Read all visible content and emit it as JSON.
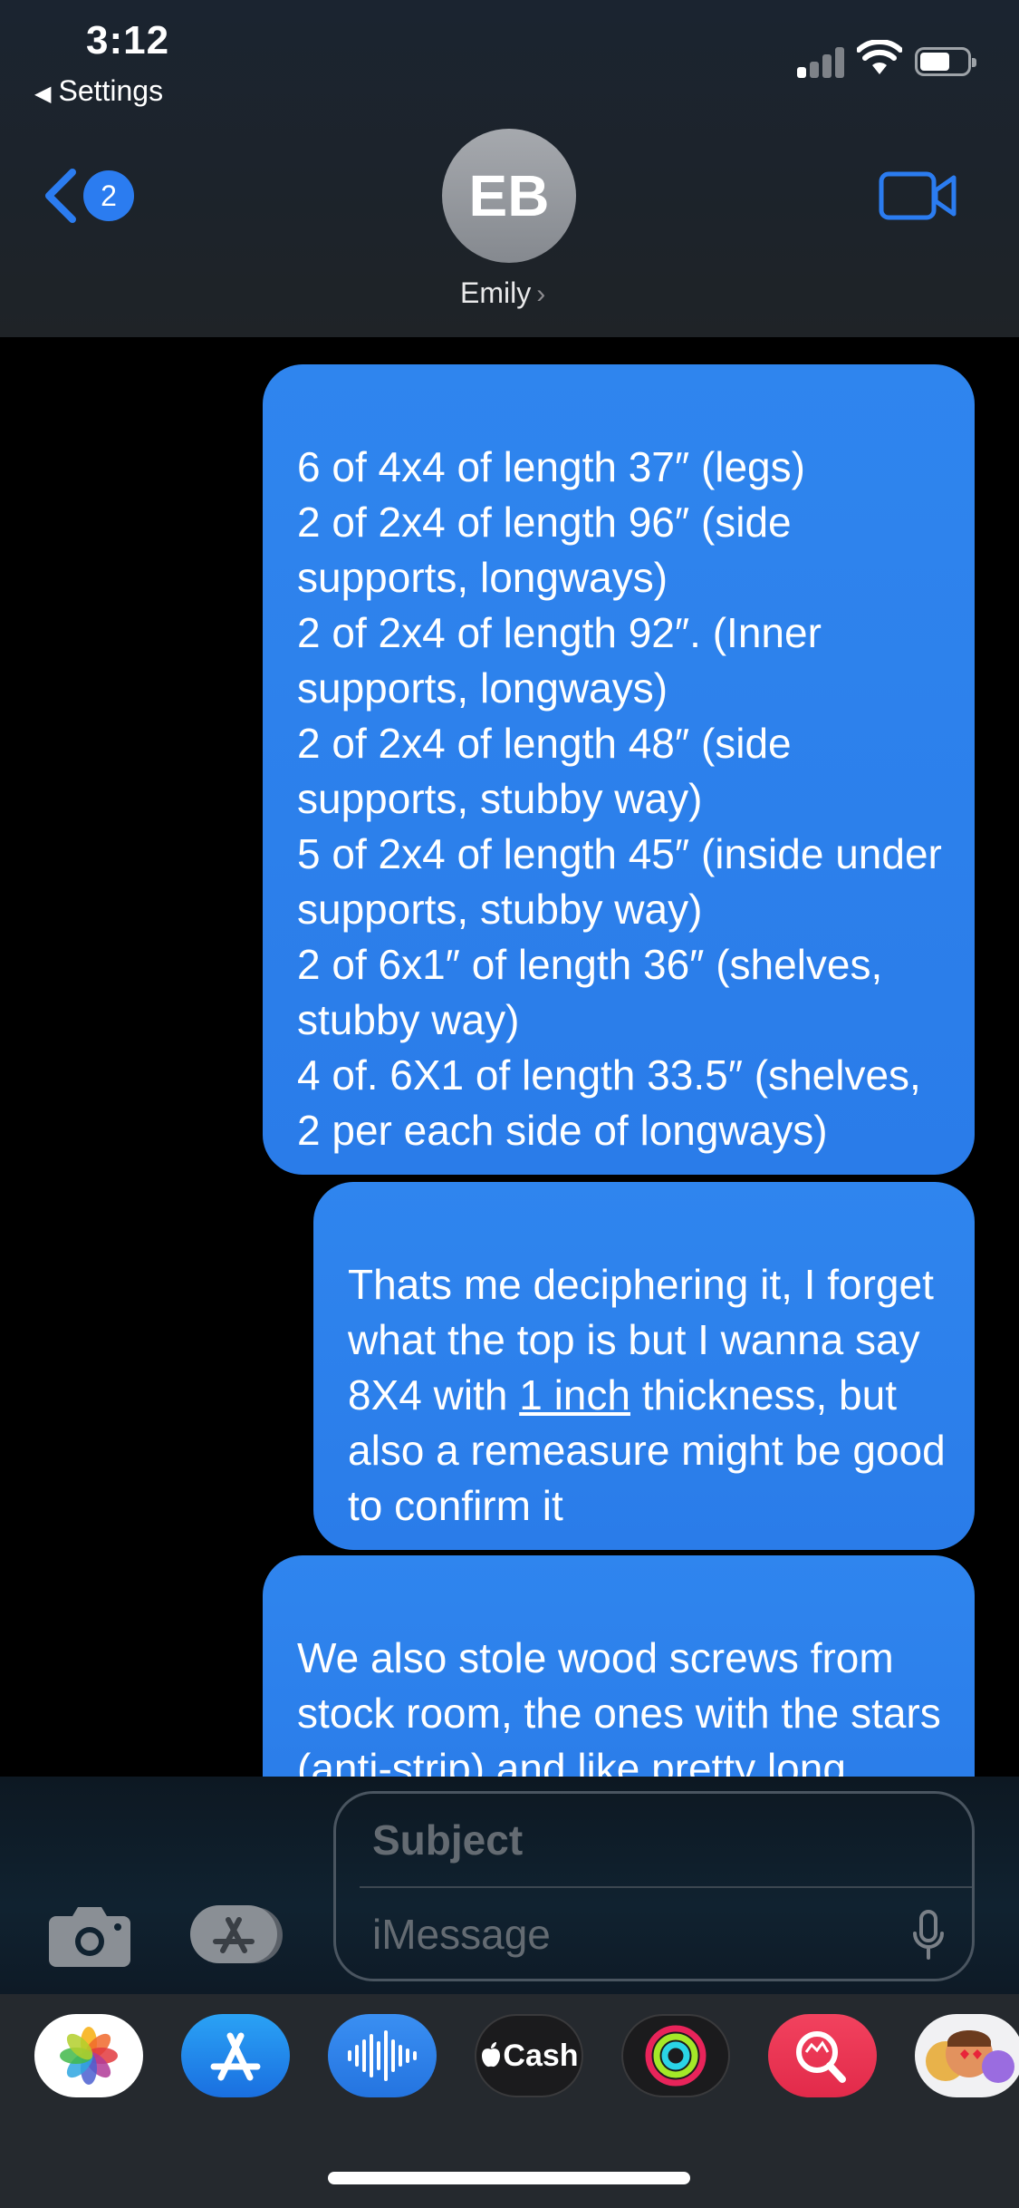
{
  "status_bar": {
    "time": "3:12",
    "back_app": "Settings",
    "back_arrow": "◀"
  },
  "nav": {
    "back_count": "2",
    "avatar_initials": "EB",
    "contact_name": "Emily",
    "contact_chevron": "›",
    "icons": [
      "chevron-left-icon",
      "video-camera-icon"
    ]
  },
  "messages": [
    {
      "text": "6 of   4x4 of length 37″ (legs)\n2 of    2x4 of length 96″ (side supports, longways)\n2 of    2x4 of length 92″.  (Inner supports, longways)\n2 of   2x4 of length 48″ (side supports, stubby way)\n5 of    2x4 of length 45″ (inside under supports, stubby way)\n2 of    6x1″ of length 36″ (shelves, stubby way)\n4 of.  6X1 of length 33.5″ (shelves, 2 per each side of longways)"
    },
    {
      "text_before": "Thats me deciphering it, I forget what the top is but I wanna say 8X4 with ",
      "link": "1 inch",
      "text_after": " thickness, but also a remeasure might be good to confirm it"
    },
    {
      "text": "We also stole wood screws from stock room, the ones with the stars (anti-strip) and like pretty long (might be some"
    }
  ],
  "composer": {
    "subject_placeholder": "Subject",
    "message_placeholder": "iMessage"
  },
  "dock": {
    "cash_label": "Cash",
    "apps": [
      "photos-icon",
      "app-store-icon",
      "audio-message-icon",
      "apple-cash-icon",
      "activity-icon",
      "image-search-icon",
      "memoji-icon"
    ]
  },
  "colors": {
    "bubble": "#2a7ce9",
    "accent": "#2b7cf0",
    "background": "#000000"
  }
}
